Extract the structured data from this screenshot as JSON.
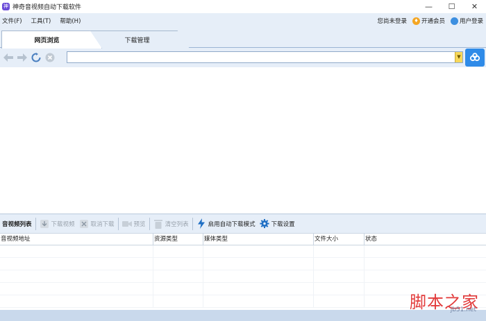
{
  "window": {
    "title": "神奇音视频自动下载软件",
    "app_icon": "神",
    "minimize": "—",
    "maximize": "☐",
    "close": "✕"
  },
  "menubar": {
    "items": [
      "文件(F)",
      "工具(T)",
      "帮助(H)"
    ],
    "login_status": "您尚未登录",
    "vip_label": "开通会员",
    "user_login": "用户登录"
  },
  "tabs": [
    {
      "label": "网页浏览",
      "active": true
    },
    {
      "label": "下载管理",
      "active": false
    }
  ],
  "navbar": {
    "url_value": "",
    "icons": [
      "back-icon",
      "forward-icon",
      "refresh-icon",
      "stop-icon"
    ]
  },
  "toolbar2": {
    "list_label": "音视频列表",
    "download_video": "下载视频",
    "cancel_download": "取消下载",
    "preview": "预览",
    "clear_list": "清空列表",
    "auto_mode": "启用自动下载模式",
    "download_settings": "下载设置"
  },
  "table": {
    "columns": [
      "音视频地址",
      "资源类型",
      "媒体类型",
      "文件大小",
      "状态"
    ]
  },
  "watermark": {
    "main": "脚本之家",
    "sub": "jb51.net"
  },
  "colors": {
    "accent": "#2f8be8",
    "chrome": "#e6eef8",
    "watermark": "#e23b3b"
  }
}
